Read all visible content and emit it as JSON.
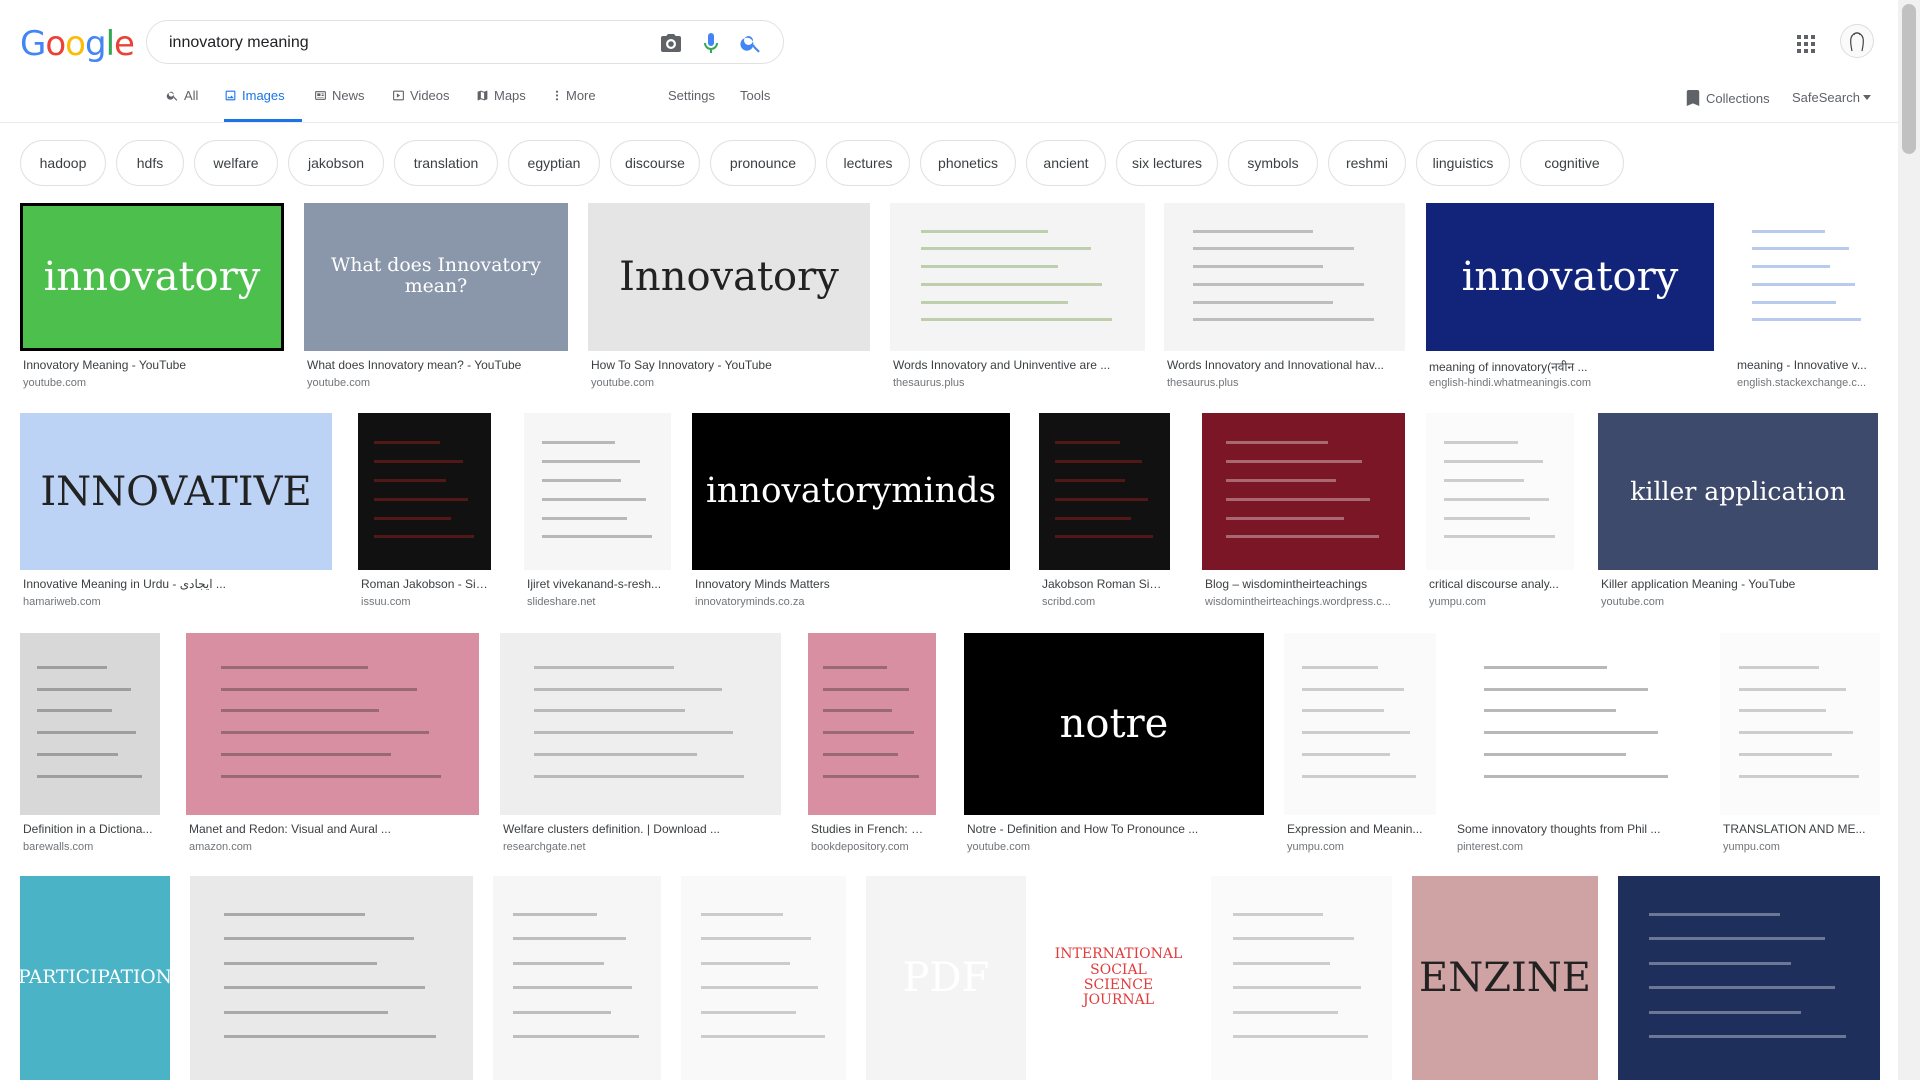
{
  "logo": {
    "letters": [
      "G",
      "o",
      "o",
      "g",
      "l",
      "e"
    ],
    "colors": [
      "#4285f4",
      "#ea4335",
      "#fbbc05",
      "#4285f4",
      "#34a853",
      "#ea4335"
    ]
  },
  "search": {
    "value": "innovatory meaning",
    "placeholder": ""
  },
  "tabs": [
    {
      "label": "All",
      "icon": "search-icon"
    },
    {
      "label": "Images",
      "icon": "image-icon"
    },
    {
      "label": "News",
      "icon": "news-icon"
    },
    {
      "label": "Videos",
      "icon": "video-icon"
    },
    {
      "label": "Maps",
      "icon": "map-icon"
    },
    {
      "label": "More",
      "icon": "more-vert-icon"
    }
  ],
  "tools": {
    "settings": "Settings",
    "tools": "Tools"
  },
  "right": {
    "collections": "Collections",
    "safesearch": "SafeSearch"
  },
  "accent": "#1a73e8",
  "chips": [
    "hadoop",
    "hdfs",
    "welfare",
    "jakobson",
    "translation",
    "egyptian",
    "discourse",
    "pronounce",
    "lectures",
    "phonetics",
    "ancient",
    "six lectures",
    "symbols",
    "reshmi",
    "linguistics",
    "cognitive"
  ],
  "results": [
    {
      "title": "Innovatory Meaning - YouTube",
      "source": "youtube.com",
      "thumb_text": "innovatory",
      "bg": "#4cbf4c",
      "fg": "#ffffff"
    },
    {
      "title": "What does Innovatory mean? - YouTube",
      "source": "youtube.com",
      "thumb_text": "What does Innovatory mean?",
      "bg": "#8a97ab",
      "fg": "#ffffff"
    },
    {
      "title": "How To Say Innovatory - YouTube",
      "source": "youtube.com",
      "thumb_text": "Innovatory",
      "bg": "#e5e5e5",
      "fg": "#222222"
    },
    {
      "title": "Words Innovatory and Uninventive are ...",
      "source": "thesaurus.plus",
      "thumb_text": "",
      "bg": "#f4f4f4",
      "fg": "#5b8a2b"
    },
    {
      "title": "Words Innovatory and Innovational hav...",
      "source": "thesaurus.plus",
      "thumb_text": "",
      "bg": "#f4f4f4",
      "fg": "#555555"
    },
    {
      "title": "meaning of innovatory(नवीन ...",
      "source": "english-hindi.whatmeaningis.com",
      "thumb_text": "innovatory",
      "bg": "#12237a",
      "fg": "#ffffff"
    },
    {
      "title": "meaning - Innovative v...",
      "source": "english.stackexchange.c...",
      "thumb_text": "",
      "bg": "#ffffff",
      "fg": "#3366cc"
    },
    {
      "title": "Innovative Meaning in Urdu - ایجادی ...",
      "source": "hamariweb.com",
      "thumb_text": "INNOVATIVE",
      "bg": "#bcd3f5",
      "fg": "#222222"
    },
    {
      "title": "Roman Jakobson - Six ...",
      "source": "issuu.com",
      "thumb_text": "",
      "bg": "#111111",
      "fg": "#cc2222"
    },
    {
      "title": "Ijiret vivekanand-s-resh...",
      "source": "slideshare.net",
      "thumb_text": "",
      "bg": "#f6f6f6",
      "fg": "#444444"
    },
    {
      "title": "Innovatory Minds Matters",
      "source": "innovatoryminds.co.za",
      "thumb_text": "innovatoryminds",
      "bg": "#000000",
      "fg": "#ffffff"
    },
    {
      "title": "Jakobson Roman Six L...",
      "source": "scribd.com",
      "thumb_text": "",
      "bg": "#111111",
      "fg": "#cc2222"
    },
    {
      "title": "Blog – wisdomintheirteachings",
      "source": "wisdomintheirteachings.wordpress.c...",
      "thumb_text": "",
      "bg": "#7a1625",
      "fg": "#ffffff"
    },
    {
      "title": "critical discourse analy...",
      "source": "yumpu.com",
      "thumb_text": "",
      "bg": "#fbfbfb",
      "fg": "#777777"
    },
    {
      "title": "Killer application Meaning - YouTube",
      "source": "youtube.com",
      "thumb_text": "killer application",
      "bg": "#3d4a6b",
      "fg": "#ffffff"
    },
    {
      "title": "Definition in a Dictiona...",
      "source": "barewalls.com",
      "thumb_text": "",
      "bg": "#d8d8d8",
      "fg": "#333333"
    },
    {
      "title": "Manet and Redon: Visual and Aural ...",
      "source": "amazon.com",
      "thumb_text": "",
      "bg": "#d98fa2",
      "fg": "#222222"
    },
    {
      "title": "Welfare clusters definition. | Download ...",
      "source": "researchgate.net",
      "thumb_text": "",
      "bg": "#eeeeee",
      "fg": "#555555"
    },
    {
      "title": "Studies in French: Mal...",
      "source": "bookdepository.com",
      "thumb_text": "",
      "bg": "#d98fa2",
      "fg": "#222222"
    },
    {
      "title": "Notre - Definition and How To Pronounce ...",
      "source": "youtube.com",
      "thumb_text": "notre",
      "bg": "#000000",
      "fg": "#ffffff"
    },
    {
      "title": "Expression and Meanin...",
      "source": "yumpu.com",
      "thumb_text": "",
      "bg": "#fafafa",
      "fg": "#777777"
    },
    {
      "title": "Some innovatory thoughts from Phil ...",
      "source": "pinterest.com",
      "thumb_text": "",
      "bg": "#ffffff",
      "fg": "#333333"
    },
    {
      "title": "TRANSLATION AND ME...",
      "source": "yumpu.com",
      "thumb_text": "",
      "bg": "#fbfbfb",
      "fg": "#777777"
    },
    {
      "title": "",
      "source": "",
      "thumb_text": "PARTICIPATION",
      "bg": "#4ab3c6",
      "fg": "#ffffff"
    },
    {
      "title": "",
      "source": "",
      "thumb_text": "",
      "bg": "#e9e9e9",
      "fg": "#333333"
    },
    {
      "title": "",
      "source": "",
      "thumb_text": "",
      "bg": "#f6f6f6",
      "fg": "#555555"
    },
    {
      "title": "",
      "source": "",
      "thumb_text": "",
      "bg": "#f9f9f9",
      "fg": "#777777"
    },
    {
      "title": "",
      "source": "",
      "thumb_text": "PDF",
      "bg": "#f4f4f4",
      "fg": "#ffffff"
    },
    {
      "title": "",
      "source": "",
      "thumb_text": "INTERNATIONAL SOCIAL SCIENCE JOURNAL",
      "bg": "#ffffff",
      "fg": "#e23b3b"
    },
    {
      "title": "",
      "source": "",
      "thumb_text": "",
      "bg": "#fafafa",
      "fg": "#777777"
    },
    {
      "title": "",
      "source": "",
      "thumb_text": "ENZINE",
      "bg": "#cfa3a3",
      "fg": "#222222"
    },
    {
      "title": "",
      "source": "",
      "thumb_text": "",
      "bg": "#1e2f5c",
      "fg": "#ffffff"
    }
  ]
}
